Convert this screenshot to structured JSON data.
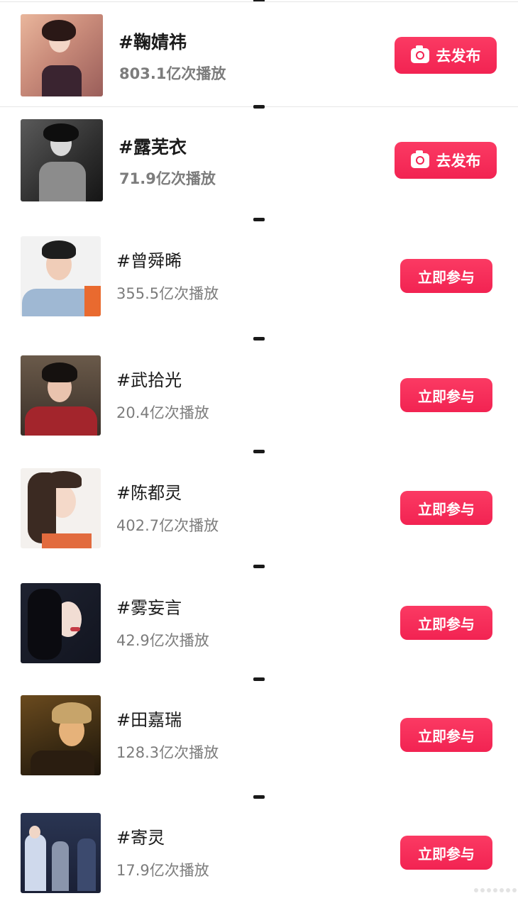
{
  "topics": [
    {
      "title": "#鞠婧祎",
      "views": "803.1亿次播放",
      "action": "去发布",
      "kind": "publish"
    },
    {
      "title": "#露芜衣",
      "views": "71.9亿次播放",
      "action": "去发布",
      "kind": "publish"
    },
    {
      "title": "#曾舜晞",
      "views": "355.5亿次播放",
      "action": "立即参与",
      "kind": "join"
    },
    {
      "title": "#武拾光",
      "views": "20.4亿次播放",
      "action": "立即参与",
      "kind": "join"
    },
    {
      "title": "#陈都灵",
      "views": "402.7亿次播放",
      "action": "立即参与",
      "kind": "join"
    },
    {
      "title": "#雾妄言",
      "views": "42.9亿次播放",
      "action": "立即参与",
      "kind": "join"
    },
    {
      "title": "#田嘉瑞",
      "views": "128.3亿次播放",
      "action": "立即参与",
      "kind": "join"
    },
    {
      "title": "#寄灵",
      "views": "17.9亿次播放",
      "action": "立即参与",
      "kind": "join"
    }
  ],
  "colors": {
    "accent": "#f22352",
    "title": "#1b1b1b",
    "subtext": "#7c7c7c"
  },
  "icons": {
    "publish_button_icon": "camera-icon"
  }
}
